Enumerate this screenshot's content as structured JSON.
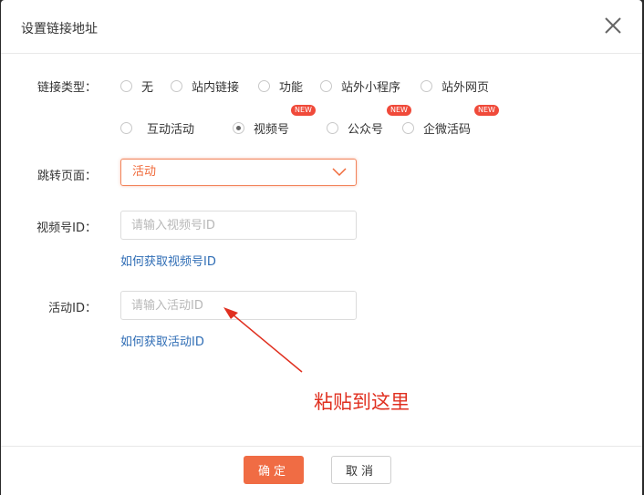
{
  "dialog": {
    "title": "设置链接地址",
    "link_type_label": "链接类型：",
    "link_type_options_row1": [
      "无",
      "站内链接",
      "功能",
      "站外小程序",
      "站外网页"
    ],
    "link_type_options_row2": [
      "互动活动",
      "视频号",
      "公众号",
      "企微活码"
    ],
    "selected_option": "视频号",
    "new_badge": "NEW",
    "jump_page_label": "跳转页面：",
    "jump_page_value": "活动",
    "channel_id_label": "视频号ID：",
    "channel_id_placeholder": "请输入视频号ID",
    "channel_id_help": "如何获取视频号ID",
    "activity_id_label": "活动ID：",
    "activity_id_placeholder": "请输入活动ID",
    "activity_id_help": "如何获取活动ID",
    "annotation": "粘贴到这里",
    "ok_label": "确定",
    "cancel_label": "取消"
  },
  "colors": {
    "accent": "#f06c44",
    "link": "#2f6db5",
    "badge": "#f04a3a",
    "annotation": "#e03020"
  }
}
